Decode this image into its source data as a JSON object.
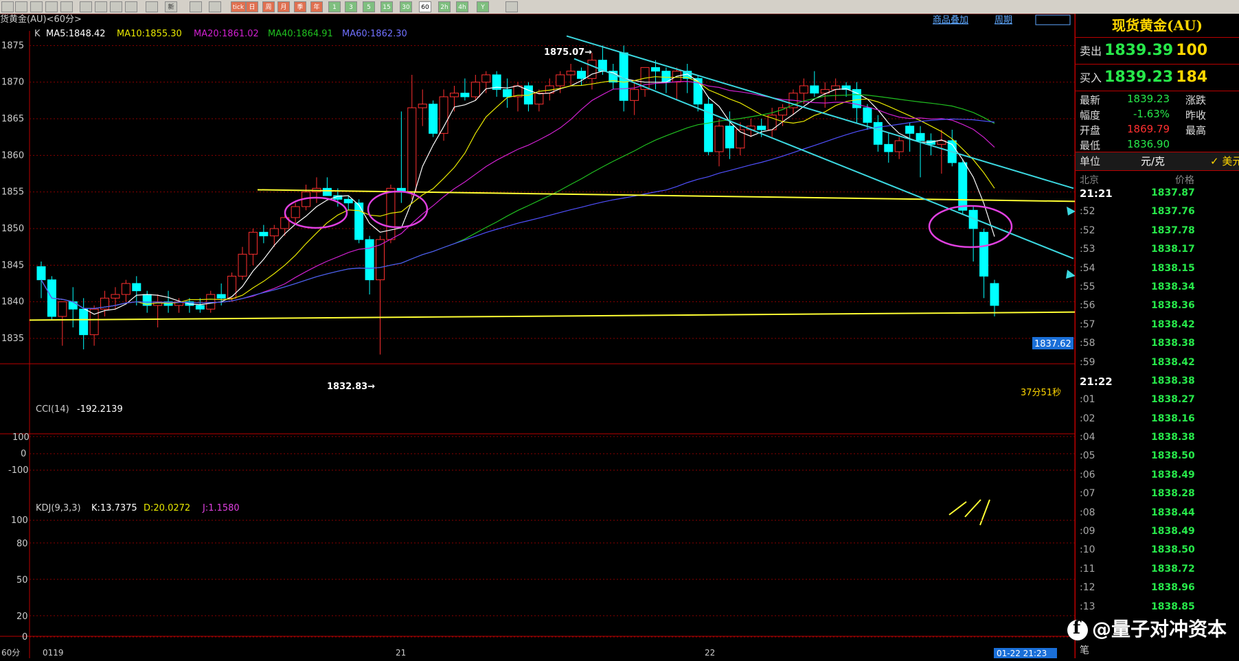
{
  "toolbar": {
    "buttons": [
      "",
      "",
      "",
      "",
      "",
      "",
      "",
      "",
      "",
      "",
      "新",
      "",
      "",
      "tick",
      "日",
      "周",
      "月",
      "季",
      "年",
      "1",
      "3",
      "5",
      "15",
      "30",
      "60",
      "2h",
      "4h",
      "Y",
      ""
    ]
  },
  "chart": {
    "title": "货黄金(AU)<60分>",
    "ma_line": {
      "k": "K",
      "ma5": "MA5:1848.42",
      "ma10": "MA10:1855.30",
      "ma20": "MA20:1861.02",
      "ma40": "MA40:1864.91",
      "ma60": "MA60:1862.30"
    },
    "top_links": {
      "overlay": "商品叠加",
      "cycle": "周期"
    },
    "price_ticks": [
      "1875",
      "1870",
      "1865",
      "1860",
      "1855",
      "1850",
      "1845",
      "1840",
      "1835"
    ],
    "high_label": "1875.07→",
    "low_label": "1832.83→",
    "last_price_tag": "1837.62",
    "countdown": "37分51秒",
    "colors": {
      "ma5": "#ffffff",
      "ma10": "#e8e800",
      "ma20": "#d020d0",
      "ma40": "#20c020",
      "ma60": "#5050ff",
      "up": "#ff3030",
      "down": "#00ffff",
      "annot": "#ffff33",
      "circle": "#e040e0",
      "trend": "#3cd8e0"
    }
  },
  "cci": {
    "label": "CCI(14)",
    "value": "-192.2139",
    "ticks": [
      "100",
      "0",
      "-100"
    ]
  },
  "kdj": {
    "label": "KDJ(9,3,3)",
    "k": "K:13.7375",
    "d": "D:20.0272",
    "j": "J:1.1580",
    "ticks": [
      "100",
      "80",
      "50",
      "20",
      "0"
    ]
  },
  "xaxis": {
    "unit": "60分",
    "labels": [
      "0119",
      "21",
      "22"
    ],
    "cursor": "01-22 21:23"
  },
  "quote": {
    "title": "现货黄金(AU)",
    "sell_label": "卖出",
    "sell_price": "1839.39",
    "sell_vol": "100",
    "buy_label": "买入",
    "buy_price": "1839.23",
    "buy_vol": "184",
    "latest_label": "最新",
    "latest": "1839.23",
    "chg_label": "涨跌",
    "range_label": "幅度",
    "range": "-1.63%",
    "prev_label": "昨收",
    "open_label": "开盘",
    "open": "1869.79",
    "high_label": "最高",
    "low_label": "最低",
    "low": "1836.90",
    "unit_label": "单位",
    "unit": "元/克",
    "usd": "美元",
    "loc_label": "北京",
    "price_label": "价格",
    "footer": "笔"
  },
  "ticks_list": [
    {
      "t": "21:21",
      "p": "1837.87",
      "big": true
    },
    {
      "t": ":52",
      "p": "1837.76"
    },
    {
      "t": ":52",
      "p": "1837.78"
    },
    {
      "t": ":53",
      "p": "1838.17"
    },
    {
      "t": ":54",
      "p": "1838.15"
    },
    {
      "t": ":55",
      "p": "1838.34"
    },
    {
      "t": ":56",
      "p": "1838.36"
    },
    {
      "t": ":57",
      "p": "1838.42"
    },
    {
      "t": ":58",
      "p": "1838.38"
    },
    {
      "t": ":59",
      "p": "1838.42"
    },
    {
      "t": "21:22",
      "p": "1838.38",
      "big": true
    },
    {
      "t": ":01",
      "p": "1838.27"
    },
    {
      "t": ":02",
      "p": "1838.16"
    },
    {
      "t": ":04",
      "p": "1838.38"
    },
    {
      "t": ":05",
      "p": "1838.50"
    },
    {
      "t": ":06",
      "p": "1838.49"
    },
    {
      "t": ":07",
      "p": "1838.28"
    },
    {
      "t": ":08",
      "p": "1838.44"
    },
    {
      "t": ":09",
      "p": "1838.49"
    },
    {
      "t": ":10",
      "p": "1838.50"
    },
    {
      "t": ":11",
      "p": "1838.72"
    },
    {
      "t": ":12",
      "p": "1838.96"
    },
    {
      "t": ":13",
      "p": "1838.85"
    }
  ],
  "watermark": "@量子对冲资本",
  "chart_data": {
    "type": "candlestick",
    "title": "货黄金(AU)<60分>",
    "ylim": [
      1832,
      1877
    ],
    "candles": [
      {
        "o": 1844.8,
        "h": 1845.5,
        "l": 1840.5,
        "c": 1843.0
      },
      {
        "o": 1843.0,
        "h": 1843.5,
        "l": 1837.5,
        "c": 1838.0
      },
      {
        "o": 1838.0,
        "h": 1840.0,
        "l": 1834.0,
        "c": 1840.0
      },
      {
        "o": 1840.0,
        "h": 1842.0,
        "l": 1836.5,
        "c": 1839.0
      },
      {
        "o": 1839.0,
        "h": 1840.5,
        "l": 1833.5,
        "c": 1835.5
      },
      {
        "o": 1835.5,
        "h": 1839.5,
        "l": 1834.0,
        "c": 1839.0
      },
      {
        "o": 1839.0,
        "h": 1841.5,
        "l": 1838.0,
        "c": 1840.5
      },
      {
        "o": 1840.5,
        "h": 1842.0,
        "l": 1839.0,
        "c": 1841.0
      },
      {
        "o": 1841.0,
        "h": 1843.0,
        "l": 1840.0,
        "c": 1842.5
      },
      {
        "o": 1842.5,
        "h": 1843.5,
        "l": 1839.5,
        "c": 1841.5
      },
      {
        "o": 1841.0,
        "h": 1841.5,
        "l": 1838.5,
        "c": 1839.5
      },
      {
        "o": 1839.5,
        "h": 1841.0,
        "l": 1836.5,
        "c": 1840.0
      },
      {
        "o": 1840.0,
        "h": 1841.5,
        "l": 1838.5,
        "c": 1839.5
      },
      {
        "o": 1839.5,
        "h": 1840.5,
        "l": 1838.5,
        "c": 1840.0
      },
      {
        "o": 1840.0,
        "h": 1840.5,
        "l": 1838.5,
        "c": 1839.5
      },
      {
        "o": 1839.5,
        "h": 1840.5,
        "l": 1838.5,
        "c": 1839.0
      },
      {
        "o": 1839.0,
        "h": 1841.5,
        "l": 1838.5,
        "c": 1841.0
      },
      {
        "o": 1841.0,
        "h": 1842.5,
        "l": 1839.5,
        "c": 1840.5
      },
      {
        "o": 1840.5,
        "h": 1844.0,
        "l": 1840.0,
        "c": 1843.5
      },
      {
        "o": 1843.5,
        "h": 1847.5,
        "l": 1843.0,
        "c": 1846.5
      },
      {
        "o": 1846.5,
        "h": 1850.0,
        "l": 1845.0,
        "c": 1849.5
      },
      {
        "o": 1849.5,
        "h": 1850.5,
        "l": 1848.0,
        "c": 1849.0
      },
      {
        "o": 1849.0,
        "h": 1850.5,
        "l": 1847.5,
        "c": 1850.0
      },
      {
        "o": 1850.0,
        "h": 1852.0,
        "l": 1849.0,
        "c": 1851.5
      },
      {
        "o": 1851.5,
        "h": 1853.5,
        "l": 1850.5,
        "c": 1853.0
      },
      {
        "o": 1853.0,
        "h": 1856.0,
        "l": 1852.5,
        "c": 1855.0
      },
      {
        "o": 1855.0,
        "h": 1857.0,
        "l": 1853.5,
        "c": 1855.5
      },
      {
        "o": 1855.5,
        "h": 1857.0,
        "l": 1854.5,
        "c": 1854.5
      },
      {
        "o": 1854.5,
        "h": 1855.5,
        "l": 1853.0,
        "c": 1854.0
      },
      {
        "o": 1854.0,
        "h": 1854.5,
        "l": 1852.5,
        "c": 1853.5
      },
      {
        "o": 1853.5,
        "h": 1854.0,
        "l": 1848.0,
        "c": 1848.5
      },
      {
        "o": 1848.5,
        "h": 1849.0,
        "l": 1841.0,
        "c": 1843.0
      },
      {
        "o": 1843.0,
        "h": 1849.0,
        "l": 1832.8,
        "c": 1848.5
      },
      {
        "o": 1848.5,
        "h": 1856.0,
        "l": 1848.0,
        "c": 1855.5
      },
      {
        "o": 1855.5,
        "h": 1866.0,
        "l": 1853.5,
        "c": 1855.0
      },
      {
        "o": 1855.0,
        "h": 1871.0,
        "l": 1854.0,
        "c": 1866.5
      },
      {
        "o": 1866.5,
        "h": 1869.0,
        "l": 1864.0,
        "c": 1867.0
      },
      {
        "o": 1867.0,
        "h": 1867.5,
        "l": 1862.5,
        "c": 1863.0
      },
      {
        "o": 1863.0,
        "h": 1869.0,
        "l": 1862.0,
        "c": 1868.0
      },
      {
        "o": 1868.0,
        "h": 1869.5,
        "l": 1866.0,
        "c": 1868.5
      },
      {
        "o": 1868.5,
        "h": 1870.5,
        "l": 1867.5,
        "c": 1868.0
      },
      {
        "o": 1868.0,
        "h": 1871.0,
        "l": 1867.5,
        "c": 1870.0
      },
      {
        "o": 1870.0,
        "h": 1871.5,
        "l": 1868.5,
        "c": 1871.0
      },
      {
        "o": 1871.0,
        "h": 1871.5,
        "l": 1868.0,
        "c": 1869.0
      },
      {
        "o": 1869.0,
        "h": 1870.5,
        "l": 1866.5,
        "c": 1868.0
      },
      {
        "o": 1868.0,
        "h": 1870.0,
        "l": 1866.0,
        "c": 1869.5
      },
      {
        "o": 1869.5,
        "h": 1870.0,
        "l": 1866.0,
        "c": 1867.0
      },
      {
        "o": 1867.0,
        "h": 1869.0,
        "l": 1866.0,
        "c": 1868.5
      },
      {
        "o": 1868.5,
        "h": 1870.5,
        "l": 1867.5,
        "c": 1869.5
      },
      {
        "o": 1869.5,
        "h": 1871.5,
        "l": 1868.5,
        "c": 1871.0
      },
      {
        "o": 1871.0,
        "h": 1872.5,
        "l": 1869.5,
        "c": 1871.5
      },
      {
        "o": 1871.5,
        "h": 1872.0,
        "l": 1869.5,
        "c": 1870.5
      },
      {
        "o": 1870.5,
        "h": 1874.0,
        "l": 1869.0,
        "c": 1873.0
      },
      {
        "o": 1873.0,
        "h": 1875.0,
        "l": 1871.0,
        "c": 1871.5
      },
      {
        "o": 1871.5,
        "h": 1872.5,
        "l": 1869.0,
        "c": 1870.0
      },
      {
        "o": 1874.0,
        "h": 1875.0,
        "l": 1866.0,
        "c": 1867.5
      },
      {
        "o": 1867.5,
        "h": 1870.0,
        "l": 1865.5,
        "c": 1869.0
      },
      {
        "o": 1869.0,
        "h": 1872.0,
        "l": 1868.0,
        "c": 1872.0
      },
      {
        "o": 1872.0,
        "h": 1873.0,
        "l": 1869.0,
        "c": 1871.5
      },
      {
        "o": 1871.5,
        "h": 1872.0,
        "l": 1868.5,
        "c": 1870.0
      },
      {
        "o": 1870.0,
        "h": 1872.0,
        "l": 1867.5,
        "c": 1871.5
      },
      {
        "o": 1871.5,
        "h": 1872.5,
        "l": 1868.5,
        "c": 1870.5
      },
      {
        "o": 1870.5,
        "h": 1871.0,
        "l": 1866.0,
        "c": 1867.0
      },
      {
        "o": 1867.0,
        "h": 1868.0,
        "l": 1860.0,
        "c": 1860.5
      },
      {
        "o": 1860.5,
        "h": 1865.0,
        "l": 1858.5,
        "c": 1864.0
      },
      {
        "o": 1864.0,
        "h": 1866.0,
        "l": 1859.5,
        "c": 1861.0
      },
      {
        "o": 1861.0,
        "h": 1864.5,
        "l": 1860.0,
        "c": 1863.5
      },
      {
        "o": 1863.5,
        "h": 1865.0,
        "l": 1862.5,
        "c": 1864.0
      },
      {
        "o": 1864.0,
        "h": 1865.0,
        "l": 1862.5,
        "c": 1863.5
      },
      {
        "o": 1863.5,
        "h": 1866.5,
        "l": 1862.5,
        "c": 1865.5
      },
      {
        "o": 1865.5,
        "h": 1867.0,
        "l": 1864.0,
        "c": 1866.5
      },
      {
        "o": 1866.5,
        "h": 1869.0,
        "l": 1865.5,
        "c": 1868.5
      },
      {
        "o": 1868.5,
        "h": 1870.5,
        "l": 1867.0,
        "c": 1869.5
      },
      {
        "o": 1869.5,
        "h": 1871.5,
        "l": 1868.0,
        "c": 1868.5
      },
      {
        "o": 1868.5,
        "h": 1870.0,
        "l": 1866.5,
        "c": 1869.0
      },
      {
        "o": 1869.0,
        "h": 1870.5,
        "l": 1867.5,
        "c": 1869.5
      },
      {
        "o": 1869.5,
        "h": 1870.0,
        "l": 1868.0,
        "c": 1869.0
      },
      {
        "o": 1869.0,
        "h": 1870.0,
        "l": 1864.5,
        "c": 1866.5
      },
      {
        "o": 1866.5,
        "h": 1867.0,
        "l": 1863.5,
        "c": 1864.5
      },
      {
        "o": 1864.5,
        "h": 1865.5,
        "l": 1860.5,
        "c": 1861.5
      },
      {
        "o": 1861.5,
        "h": 1863.0,
        "l": 1859.0,
        "c": 1860.5
      },
      {
        "o": 1860.5,
        "h": 1862.5,
        "l": 1859.5,
        "c": 1862.0
      },
      {
        "o": 1864.0,
        "h": 1864.5,
        "l": 1860.5,
        "c": 1863.0
      },
      {
        "o": 1863.0,
        "h": 1864.0,
        "l": 1857.0,
        "c": 1862.0
      },
      {
        "o": 1862.0,
        "h": 1863.0,
        "l": 1860.0,
        "c": 1861.5
      },
      {
        "o": 1861.5,
        "h": 1863.5,
        "l": 1857.5,
        "c": 1862.0
      },
      {
        "o": 1862.0,
        "h": 1863.5,
        "l": 1858.5,
        "c": 1859.0
      },
      {
        "o": 1859.0,
        "h": 1859.5,
        "l": 1852.0,
        "c": 1852.5
      },
      {
        "o": 1852.5,
        "h": 1853.0,
        "l": 1845.5,
        "c": 1850.0
      },
      {
        "o": 1849.5,
        "h": 1850.0,
        "l": 1840.5,
        "c": 1843.5
      },
      {
        "o": 1842.5,
        "h": 1843.0,
        "l": 1838.0,
        "c": 1839.5
      }
    ]
  }
}
